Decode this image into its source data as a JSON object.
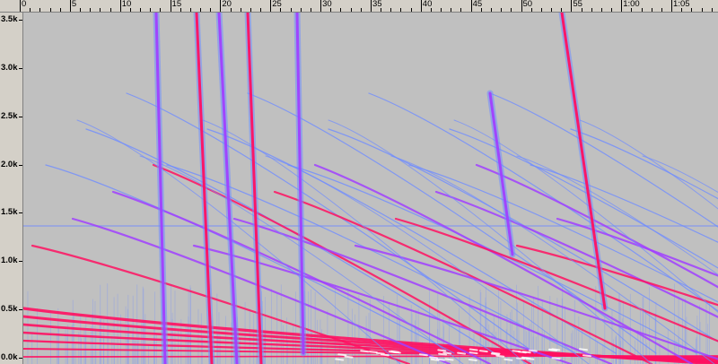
{
  "timeline": {
    "labels": [
      "0",
      "5",
      "10",
      "15",
      "20",
      "25",
      "30",
      "35",
      "40",
      "45",
      "50",
      "55",
      "1:00",
      "1:05",
      "1:1"
    ]
  },
  "frequency_axis": {
    "labels": [
      "3.5k",
      "3.0k",
      "2.5k",
      "2.0k",
      "1.5k",
      "1.0k",
      "0.5k",
      "0.0k"
    ]
  },
  "spectrogram": {
    "colors": {
      "background": "#c0c0c0",
      "low": "#6f8cff",
      "mid": "#a040ff",
      "high": "#ff1060",
      "peak": "#ffffff"
    },
    "display": "spectrogram"
  }
}
